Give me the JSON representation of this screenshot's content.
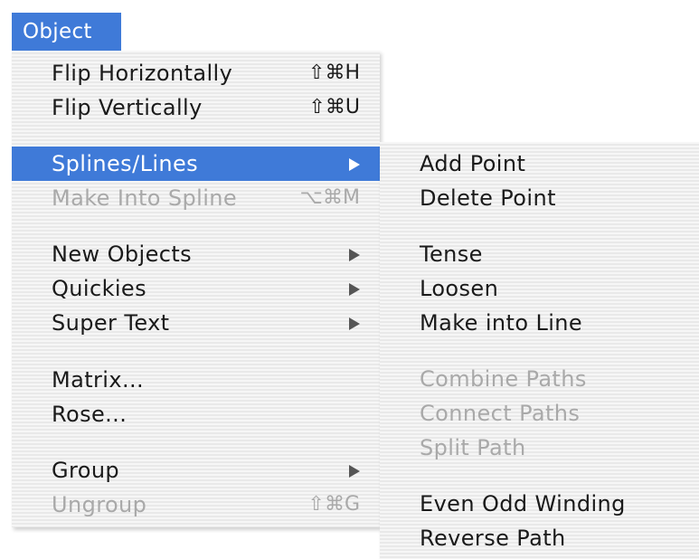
{
  "menu_bar": {
    "title": "Object"
  },
  "object_menu": {
    "items": [
      {
        "label": "Flip Horizontally",
        "shortcut": "⇧⌘H"
      },
      {
        "label": "Flip Vertically",
        "shortcut": "⇧⌘U"
      },
      {
        "label": "Splines/Lines"
      },
      {
        "label": "Make Into Spline",
        "shortcut": "⌥⌘M"
      },
      {
        "label": "New Objects"
      },
      {
        "label": "Quickies"
      },
      {
        "label": "Super Text"
      },
      {
        "label": "Matrix..."
      },
      {
        "label": "Rose..."
      },
      {
        "label": "Group"
      },
      {
        "label": "Ungroup",
        "shortcut": "⇧⌘G"
      }
    ]
  },
  "splines_submenu": {
    "items": [
      {
        "label": "Add Point"
      },
      {
        "label": "Delete Point"
      },
      {
        "label": "Tense"
      },
      {
        "label": "Loosen"
      },
      {
        "label": "Make into Line"
      },
      {
        "label": "Combine Paths"
      },
      {
        "label": "Connect Paths"
      },
      {
        "label": "Split Path"
      },
      {
        "label": "Even Odd Winding"
      },
      {
        "label": "Reverse Path"
      }
    ]
  },
  "colors": {
    "highlight": "#3f7ad8",
    "disabled_text": "#a9a9a9",
    "enabled_text": "#1a1a1a"
  },
  "icons": {
    "submenu_arrow": "chevron-right-icon"
  }
}
